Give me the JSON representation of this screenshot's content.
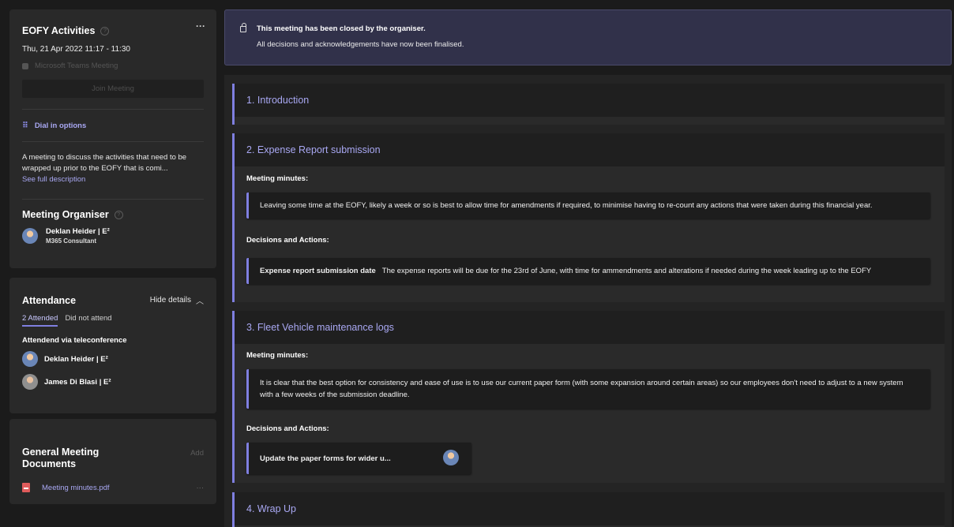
{
  "meeting": {
    "title": "EOFY Activities",
    "date": "Thu, 21 Apr 2022  11:17 - 11:30",
    "platform": "Microsoft Teams Meeting",
    "join_label": "Join Meeting",
    "dial_label": "Dial in options",
    "description": "A meeting to discuss the activities that need to be wrapped up prior to the EOFY that is comi...",
    "see_full": "See full description"
  },
  "organiser": {
    "heading": "Meeting Organiser",
    "name": "Deklan Heider | E²",
    "role": "M365 Consultant"
  },
  "attendance": {
    "heading": "Attendance",
    "toggle_label": "Hide details",
    "tabs": [
      "2 Attended",
      "Did not attend"
    ],
    "sub_heading": "Attendend via teleconference",
    "people": [
      "Deklan Heider | E²",
      "James Di Blasi | E²"
    ]
  },
  "documents": {
    "heading": "General Meeting Documents",
    "add_label": "Add",
    "files": [
      "Meeting minutes.pdf"
    ]
  },
  "banner": {
    "line1": "This meeting has been closed by the organiser.",
    "line2": "All decisions and acknowledgements have now been finalised."
  },
  "agenda": [
    {
      "title": "1. Introduction"
    },
    {
      "title": "2. Expense Report submission",
      "minutes_label": "Meeting minutes:",
      "minutes": "Leaving some time at the EOFY, likely a week or so is best to allow time for amendments if required, to minimise having to re-count any actions that were taken during this financial year.",
      "decisions_label": "Decisions and Actions:",
      "decision_title": "Expense report submission date",
      "decision_text": "The expense reports will be due for the 23rd of June, with time for ammendments and alterations if needed during the week leading up to the EOFY"
    },
    {
      "title": "3. Fleet Vehicle maintenance logs",
      "minutes_label": "Meeting minutes:",
      "minutes": "It is clear that the best option for consistency and ease of use is to use our current paper form (with some expansion around certain areas) so our employees don't need to adjust to a new system with a few weeks of the submission deadline.",
      "decisions_label": "Decisions and Actions:",
      "task": "Update the paper forms for wider u..."
    },
    {
      "title": "4. Wrap Up"
    }
  ],
  "colors": {
    "accent": "#7f7fe0",
    "link": "#a9a8f3",
    "panel": "#292929",
    "background": "#1b1b1b"
  }
}
